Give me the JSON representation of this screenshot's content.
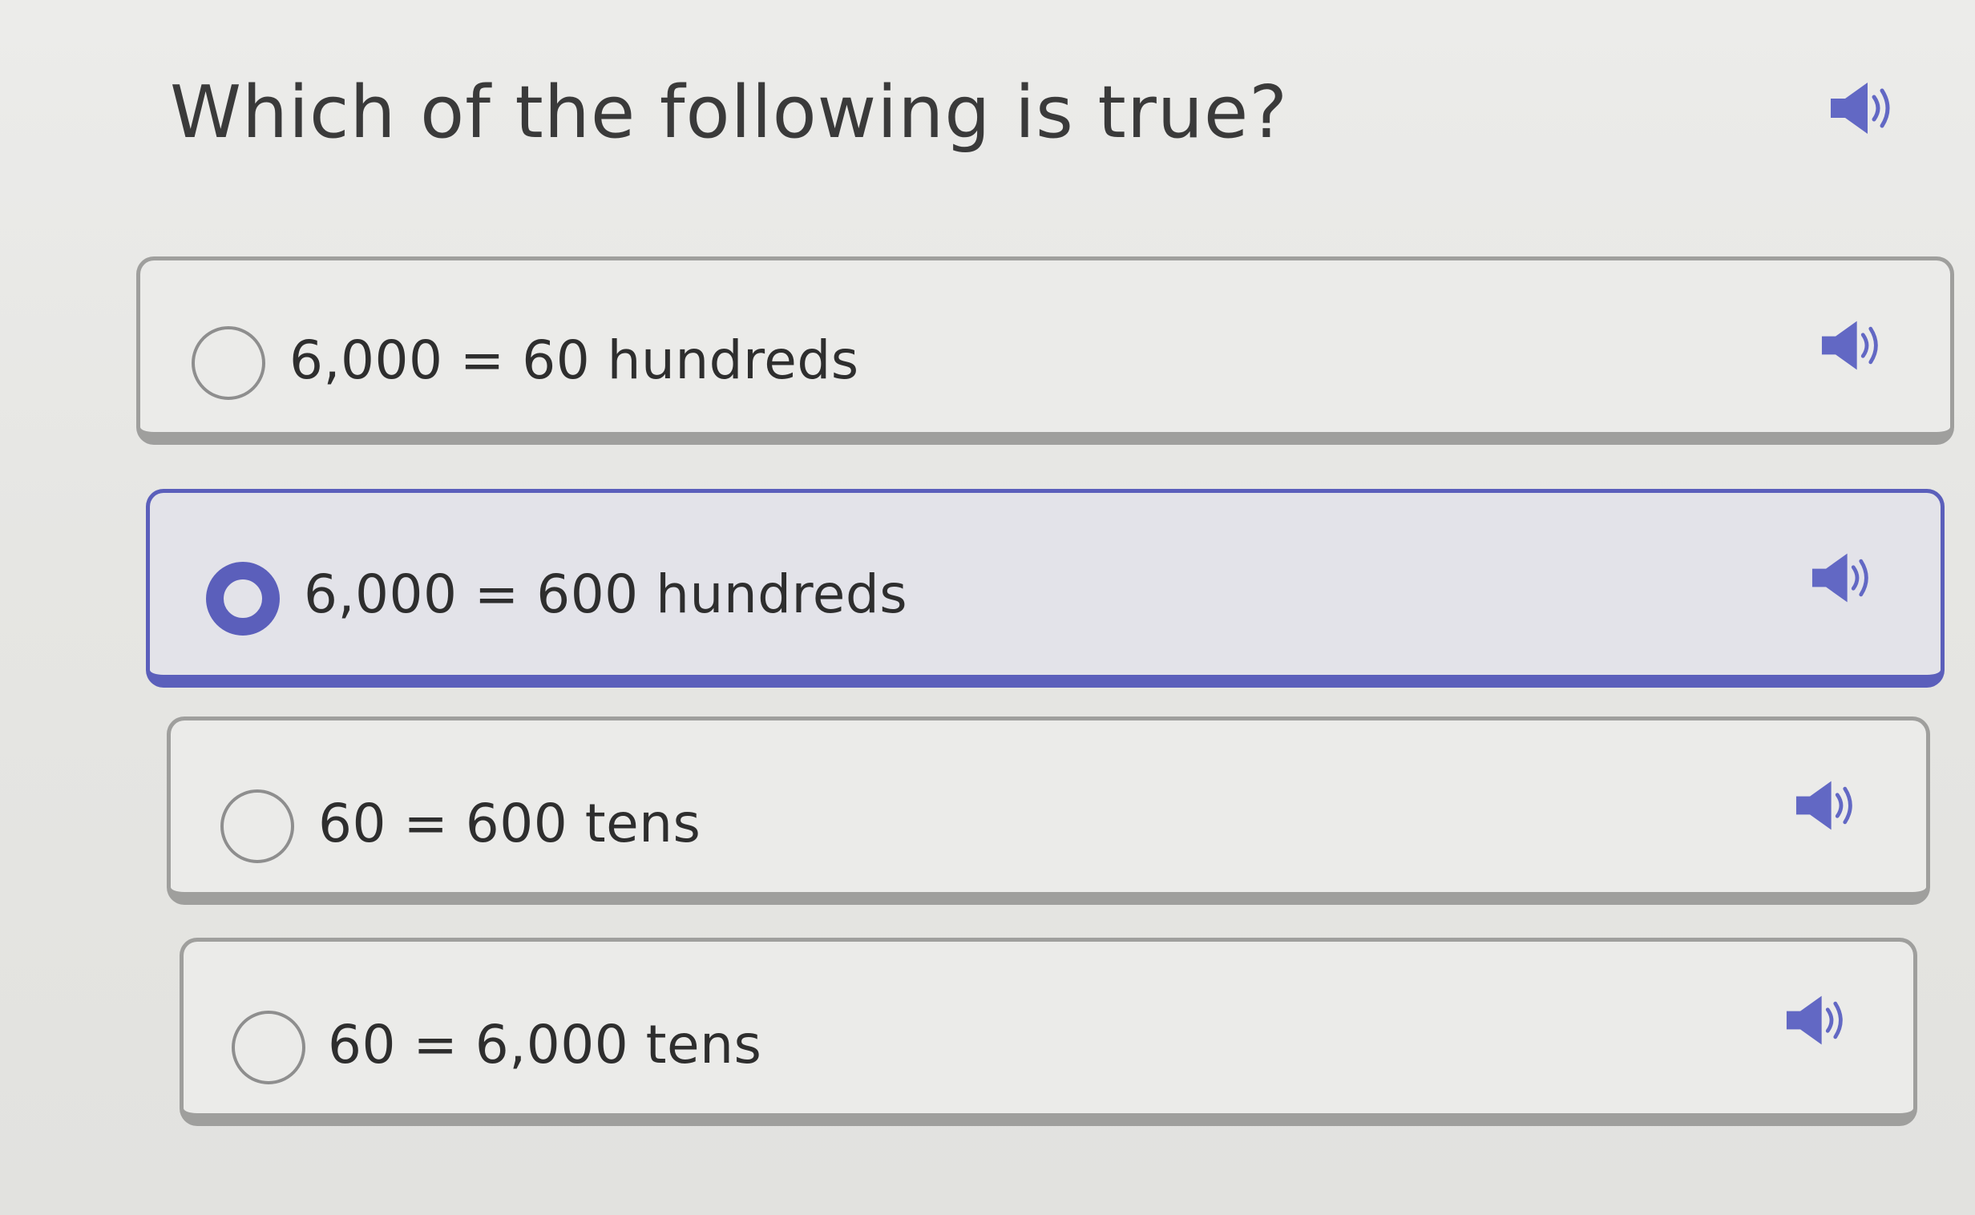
{
  "question": {
    "text": "Which of the following is true?",
    "speaker_icon": "speaker-icon"
  },
  "choices": [
    {
      "label": "6,000 = 60 hundreds",
      "selected": false,
      "speaker_icon": "speaker-icon"
    },
    {
      "label": "6,000 = 600 hundreds",
      "selected": true,
      "speaker_icon": "speaker-icon"
    },
    {
      "label": "60 = 600 tens",
      "selected": false,
      "speaker_icon": "speaker-icon"
    },
    {
      "label": "60 = 6,000 tens",
      "selected": false,
      "speaker_icon": "speaker-icon"
    }
  ],
  "colors": {
    "accent": "#5b5fbb",
    "speaker": "#6268c4",
    "border": "#9f9f9d",
    "text": "#2e2e2e"
  }
}
